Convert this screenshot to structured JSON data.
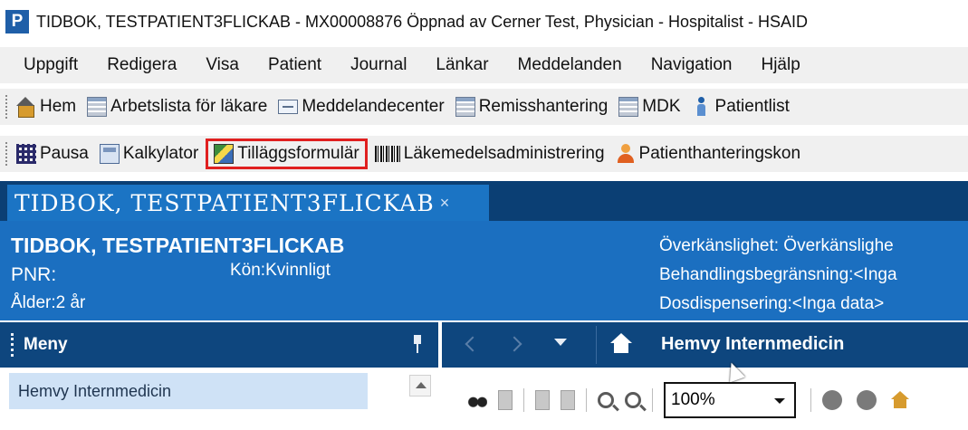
{
  "window": {
    "app_icon_letter": "P",
    "title": "TIDBOK, TESTPATIENT3FLICKAB - MX00008876 Öppnad av Cerner Test, Physician - Hospitalist - HSAID"
  },
  "menubar": {
    "items": [
      "Uppgift",
      "Redigera",
      "Visa",
      "Patient",
      "Journal",
      "Länkar",
      "Meddelanden",
      "Navigation",
      "Hjälp"
    ]
  },
  "toolbar1": {
    "items": [
      {
        "label": "Hem",
        "icon": "home-icon"
      },
      {
        "label": "Arbetslista för läkare",
        "icon": "worklist-icon"
      },
      {
        "label": "Meddelandecenter",
        "icon": "message-icon"
      },
      {
        "label": "Remisshantering",
        "icon": "referral-icon"
      },
      {
        "label": "MDK",
        "icon": "mdk-icon"
      },
      {
        "label": "Patientlist",
        "icon": "patient-list-icon"
      }
    ]
  },
  "toolbar2": {
    "items": [
      {
        "label": "Pausa",
        "icon": "pause-icon"
      },
      {
        "label": "Kalkylator",
        "icon": "calculator-icon"
      },
      {
        "label": "Tilläggsformulär",
        "icon": "form-icon"
      },
      {
        "label": "Läkemedelsadministrering",
        "icon": "barcode-icon"
      },
      {
        "label": "Patienthanteringskon",
        "icon": "patient-management-icon"
      }
    ],
    "highlight_color": "#e02020"
  },
  "tab": {
    "label": "TIDBOK, TESTPATIENT3FLICKAB",
    "close": "×"
  },
  "banner": {
    "name": "TIDBOK, TESTPATIENT3FLICKAB",
    "pnr": "PNR:",
    "kon": "Kön:Kvinnligt",
    "alder": "Ålder:2 år",
    "right": [
      "Överkänslighet: Överkänslighe",
      "Behandlingsbegränsning:<Inga",
      "Dosdispensering:<Inga data>"
    ]
  },
  "sidebar": {
    "title": "Meny",
    "items": [
      "Hemvy Internmedicin"
    ]
  },
  "main": {
    "nav_title": "Hemvy Internmedicin",
    "zoom": "100%"
  },
  "colors": {
    "tab_bar": "#0b3f74",
    "tab_active": "#1b74c4",
    "banner": "#1b6fc0",
    "sidebar_header": "#0e467e",
    "sidebar_item": "#cfe2f6"
  }
}
